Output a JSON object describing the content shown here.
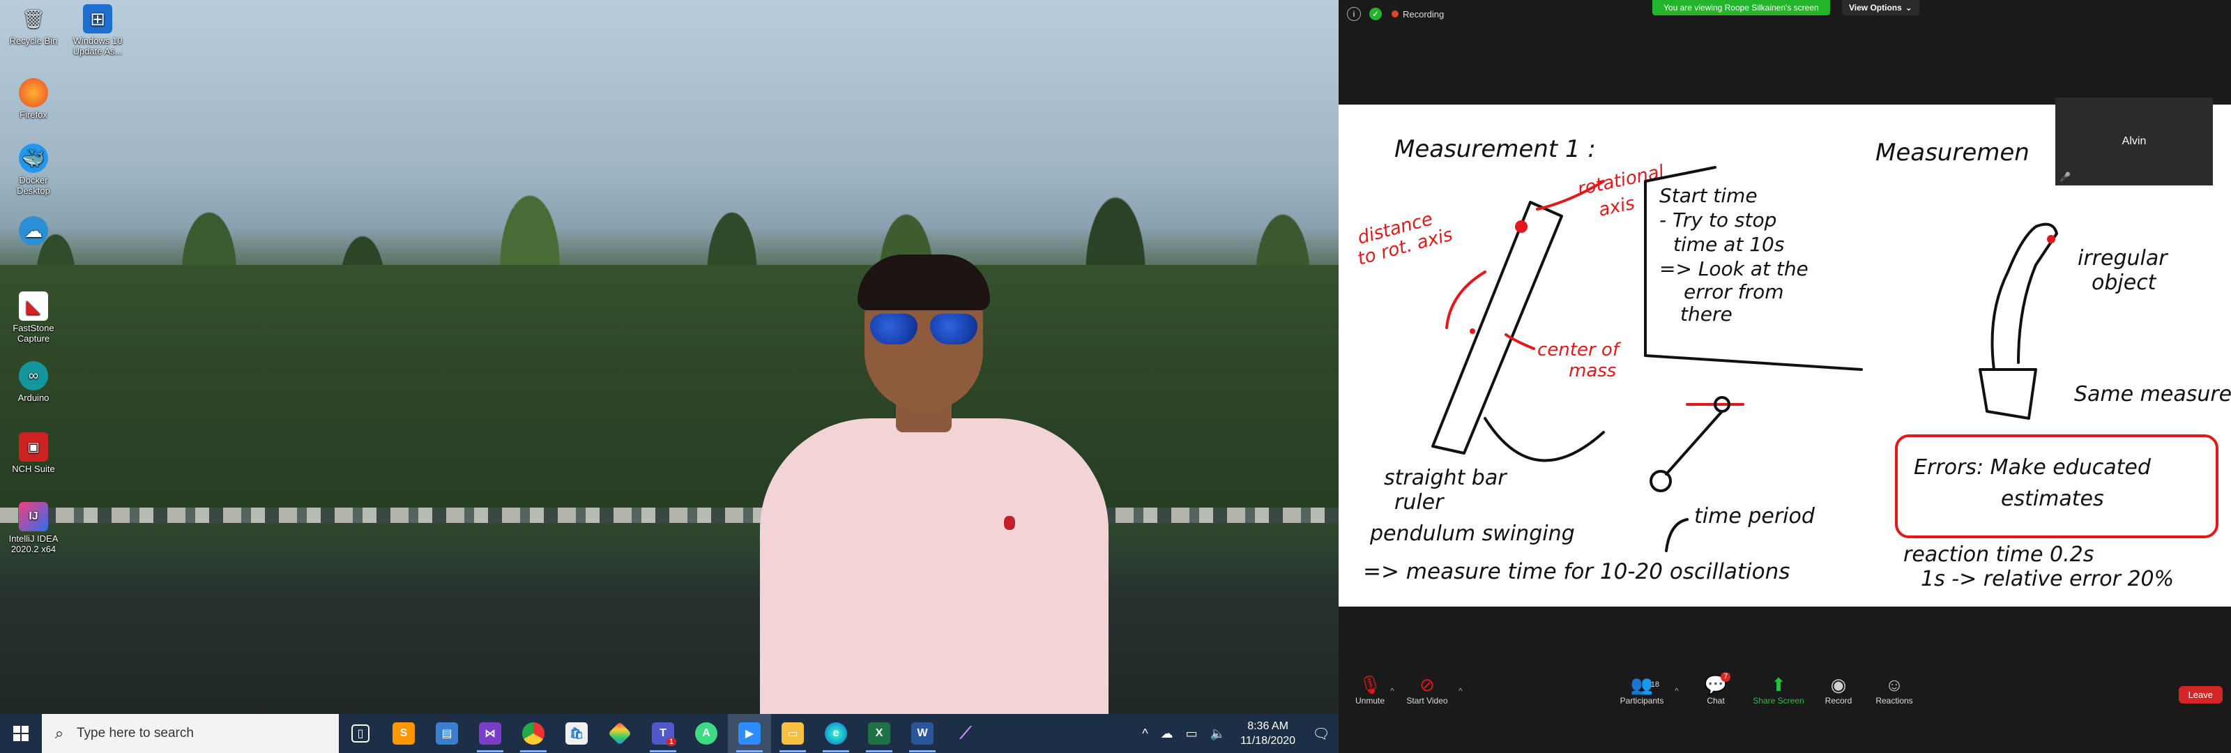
{
  "desktop": {
    "icons": [
      {
        "label": "Recycle Bin",
        "icon": "recycle-bin-icon"
      },
      {
        "label": "Windows 10 Update As...",
        "icon": "windows-update-icon"
      },
      {
        "label": "Firefox",
        "icon": "firefox-icon"
      },
      {
        "label": "Docker Desktop",
        "icon": "docker-icon"
      },
      {
        "label": "",
        "icon": "cloud-app-icon"
      },
      {
        "label": "FastStone Capture",
        "icon": "faststone-icon"
      },
      {
        "label": "Arduino",
        "icon": "arduino-icon"
      },
      {
        "label": "NCH Suite",
        "icon": "nch-icon"
      },
      {
        "label": "IntelliJ IDEA 2020.2 x64",
        "icon": "intellij-icon"
      }
    ]
  },
  "taskbar": {
    "search_placeholder": "Type here to search",
    "clock_time": "8:36 AM",
    "clock_date": "11/18/2020",
    "teams_badge": "1",
    "apps": [
      "task-view",
      "sublime",
      "file-explorer-2",
      "visual-studio",
      "chrome",
      "store",
      "git",
      "teams",
      "android-studio",
      "zoom",
      "file-explorer",
      "edge",
      "excel",
      "word",
      "feather"
    ]
  },
  "zoom": {
    "recording_label": "Recording",
    "viewing_banner": "You are viewing Roope Silkainen's screen",
    "view_options": "View Options",
    "participant_tile_name": "Alvin",
    "toolbar": {
      "unmute": "Unmute",
      "start_video": "Start Video",
      "participants": "Participants",
      "participants_count": "18",
      "chat": "Chat",
      "chat_badge": "7",
      "share_screen": "Share Screen",
      "record": "Record",
      "reactions": "Reactions",
      "leave": "Leave"
    }
  },
  "whiteboard": {
    "measurement1": "Measurement 1 :",
    "measurement2": "Measuremen",
    "rotational_axis_1": "rotational",
    "rotational_axis_2": "axis",
    "distance_1": "distance",
    "distance_2": "to rot. axis",
    "center_1": "center of",
    "center_2": "mass",
    "start_1": "Start time",
    "start_2": "- Try to stop",
    "start_3": "time at 10s",
    "start_4": "=> Look at the",
    "start_5": "error from",
    "start_6": "there",
    "irregular_1": "irregular",
    "irregular_2": "object",
    "same": "Same measurement",
    "errors_1": "Errors: Make educated",
    "errors_2": "estimates",
    "straight_bar": "straight bar",
    "ruler": "ruler",
    "pendulum": "pendulum swinging",
    "time_period": "time period",
    "measure": "=> measure time for 10-20 oscillations",
    "reaction": "reaction time 0.2s",
    "relative": "1s -> relative error 20%"
  }
}
